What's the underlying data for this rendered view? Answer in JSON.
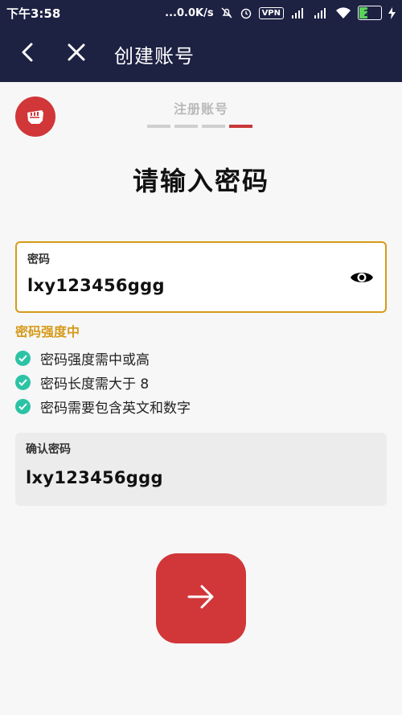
{
  "status_bar": {
    "time": "下午3:58",
    "network_speed": "...0.0K/s",
    "vpn": "VPN",
    "battery_level": "23",
    "icons": [
      "mute-icon",
      "alarm-icon",
      "vpn-icon",
      "signal-hd-icon",
      "signal-icon",
      "wifi-icon",
      "battery-icon",
      "charging-icon"
    ]
  },
  "app_bar": {
    "title": "创建账号",
    "back_icon": "back-arrow-icon",
    "close_icon": "close-icon"
  },
  "header": {
    "logo_icon": "fist-logo-icon",
    "step_label": "注册账号",
    "progress": {
      "total_steps": 4,
      "current_step": 4
    },
    "heading": "请输入密码"
  },
  "password_field": {
    "label": "密码",
    "value": "lxy123456ggg",
    "toggle_icon": "eye-icon"
  },
  "strength_text": "密码强度中",
  "rules": [
    {
      "text": "密码强度需中或高",
      "met": true
    },
    {
      "text": "密码长度需大于 8",
      "met": true
    },
    {
      "text": "密码需要包含英文和数字",
      "met": true
    }
  ],
  "confirm_field": {
    "label": "确认密码",
    "value": "lxy123456ggg"
  },
  "next_button": {
    "icon": "arrow-right-icon"
  },
  "colors": {
    "header_bg": "#1d2142",
    "accent_red": "#d13639",
    "warning": "#d69a1a",
    "check": "#2cc3a5"
  }
}
